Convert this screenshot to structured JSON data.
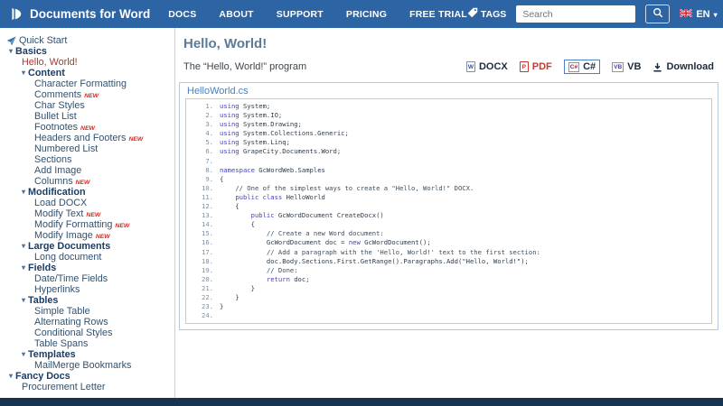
{
  "header": {
    "brand": "Documents for Word",
    "nav": [
      "DOCS",
      "ABOUT",
      "SUPPORT",
      "PRICING",
      "FREE TRIAL"
    ],
    "tags_label": "TAGS",
    "search_placeholder": "Search",
    "lang": "EN"
  },
  "sidebar": {
    "items": [
      {
        "label": "Quick Start",
        "indent": 0,
        "icon": "quickstart"
      },
      {
        "label": "Basics",
        "indent": 0,
        "bold": true,
        "caret": true
      },
      {
        "label": "Hello, World!",
        "indent": 1,
        "active": true
      },
      {
        "label": "Content",
        "indent": 2,
        "bold": true,
        "caret": true
      },
      {
        "label": "Character Formatting",
        "indent": 3
      },
      {
        "label": "Comments",
        "indent": 3,
        "isNew": true
      },
      {
        "label": "Char Styles",
        "indent": 3
      },
      {
        "label": "Bullet List",
        "indent": 3
      },
      {
        "label": "Footnotes",
        "indent": 3,
        "isNew": true
      },
      {
        "label": "Headers and Footers",
        "indent": 3,
        "isNew": true
      },
      {
        "label": "Numbered List",
        "indent": 3
      },
      {
        "label": "Sections",
        "indent": 3
      },
      {
        "label": "Add Image",
        "indent": 3
      },
      {
        "label": "Columns",
        "indent": 3,
        "isNew": true
      },
      {
        "label": "Modification",
        "indent": 2,
        "bold": true,
        "caret": true
      },
      {
        "label": "Load DOCX",
        "indent": 3
      },
      {
        "label": "Modify Text",
        "indent": 3,
        "isNew": true
      },
      {
        "label": "Modify Formatting",
        "indent": 3,
        "isNew": true
      },
      {
        "label": "Modify Image",
        "indent": 3,
        "isNew": true
      },
      {
        "label": "Large Documents",
        "indent": 2,
        "bold": true,
        "caret": true
      },
      {
        "label": "Long document",
        "indent": 3
      },
      {
        "label": "Fields",
        "indent": 2,
        "bold": true,
        "caret": true
      },
      {
        "label": "Date/Time Fields",
        "indent": 3
      },
      {
        "label": "Hyperlinks",
        "indent": 3
      },
      {
        "label": "Tables",
        "indent": 2,
        "bold": true,
        "caret": true
      },
      {
        "label": "Simple Table",
        "indent": 3
      },
      {
        "label": "Alternating Rows",
        "indent": 3
      },
      {
        "label": "Conditional Styles",
        "indent": 3
      },
      {
        "label": "Table Spans",
        "indent": 3
      },
      {
        "label": "Templates",
        "indent": 2,
        "bold": true,
        "caret": true
      },
      {
        "label": "MailMerge Bookmarks",
        "indent": 3
      },
      {
        "label": "Fancy Docs",
        "indent": 0,
        "bold": true,
        "caret": true
      },
      {
        "label": "Procurement Letter",
        "indent": 1
      }
    ]
  },
  "main": {
    "title": "Hello, World!",
    "subtitle": "The “Hello, World!” program",
    "toolbar": [
      {
        "label": "DOCX"
      },
      {
        "label": "PDF"
      },
      {
        "label": "C#",
        "selected": true
      },
      {
        "label": "VB"
      },
      {
        "label": "Download"
      }
    ],
    "code": {
      "filename": "HelloWorld.cs",
      "lines": [
        [
          [
            "k",
            "using"
          ],
          [
            "p",
            " System;"
          ]
        ],
        [
          [
            "k",
            "using"
          ],
          [
            "p",
            " System.IO;"
          ]
        ],
        [
          [
            "k",
            "using"
          ],
          [
            "p",
            " System.Drawing;"
          ]
        ],
        [
          [
            "k",
            "using"
          ],
          [
            "p",
            " System.Collections.Generic;"
          ]
        ],
        [
          [
            "k",
            "using"
          ],
          [
            "p",
            " System.Linq;"
          ]
        ],
        [
          [
            "k",
            "using"
          ],
          [
            "p",
            " GrapeCity.Documents.Word;"
          ]
        ],
        [
          [
            "p",
            " "
          ]
        ],
        [
          [
            "k",
            "namespace"
          ],
          [
            "p",
            " GcWordWeb.Samples"
          ]
        ],
        [
          [
            "p",
            "{"
          ]
        ],
        [
          [
            "p",
            "    "
          ],
          [
            "c",
            "// One of the simplest ways to create a \"Hello, World!\" DOCX."
          ]
        ],
        [
          [
            "p",
            "    "
          ],
          [
            "k",
            "public"
          ],
          [
            "p",
            " "
          ],
          [
            "k",
            "class"
          ],
          [
            "p",
            " HelloWorld"
          ]
        ],
        [
          [
            "p",
            "    {"
          ]
        ],
        [
          [
            "p",
            "        "
          ],
          [
            "k",
            "public"
          ],
          [
            "p",
            " GcWordDocument CreateDocx()"
          ]
        ],
        [
          [
            "p",
            "        {"
          ]
        ],
        [
          [
            "p",
            "            "
          ],
          [
            "c",
            "// Create a new Word document:"
          ]
        ],
        [
          [
            "p",
            "            GcWordDocument doc = "
          ],
          [
            "k",
            "new"
          ],
          [
            "p",
            " GcWordDocument();"
          ]
        ],
        [
          [
            "p",
            "            "
          ],
          [
            "c",
            "// Add a paragraph with the 'Hello, World!' text to the first section:"
          ]
        ],
        [
          [
            "p",
            "            doc.Body.Sections.First.GetRange().Paragraphs.Add("
          ],
          [
            "s",
            "\"Hello, World!\""
          ],
          [
            "p",
            ");"
          ]
        ],
        [
          [
            "p",
            "            "
          ],
          [
            "c",
            "// Done:"
          ]
        ],
        [
          [
            "p",
            "            "
          ],
          [
            "k",
            "return"
          ],
          [
            "p",
            " doc;"
          ]
        ],
        [
          [
            "p",
            "        }"
          ]
        ],
        [
          [
            "p",
            "    }"
          ]
        ],
        [
          [
            "p",
            "}"
          ]
        ],
        [
          [
            "p",
            " "
          ]
        ]
      ]
    }
  },
  "colors": {
    "header_blue": "#2d64a4",
    "footer_navy": "#16334f",
    "active_item_red": "#a23b32",
    "new_badge_red": "#e2231a",
    "keyword_blue": "#4242c8",
    "title_slate": "#5b7a96",
    "filename_blue": "#4a80c4",
    "pdf_red": "#c23b2e"
  }
}
